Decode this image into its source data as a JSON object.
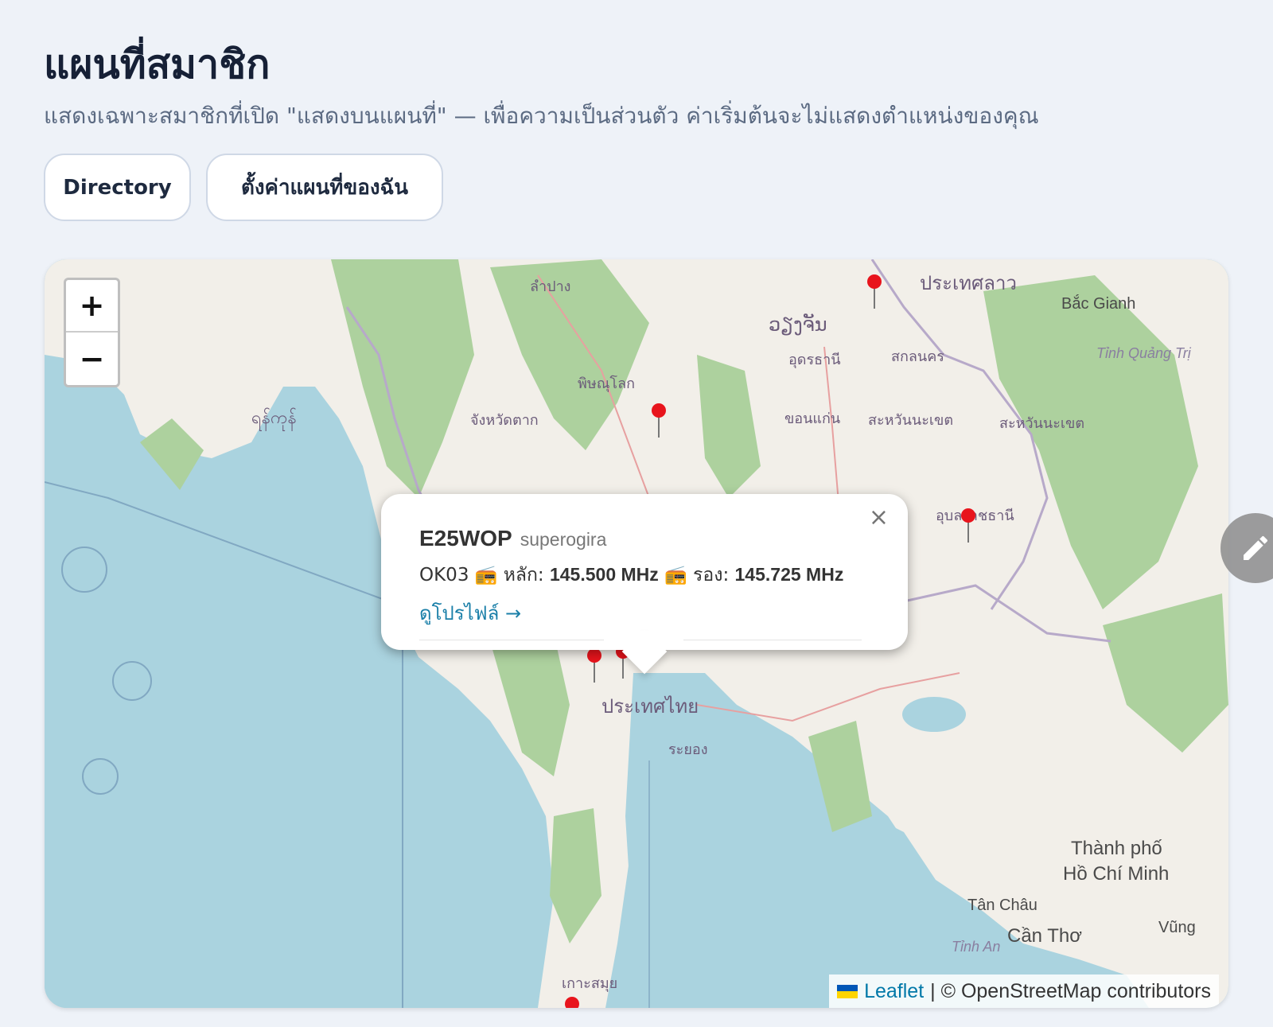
{
  "page": {
    "title": "แผนที่สมาชิก",
    "subtitle": "แสดงเฉพาะสมาชิกที่เปิด \"แสดงบนแผนที่\" — เพื่อความเป็นส่วนตัว ค่าเริ่มต้นจะไม่แสดงตำแหน่งของคุณ"
  },
  "actions": {
    "directory_label": "Directory",
    "my_map_settings_label": "ตั้งค่าแผนที่ของฉัน"
  },
  "map": {
    "zoom_in_label": "+",
    "zoom_out_label": "−",
    "marker_count": 6,
    "place_labels": {
      "lampang": "ลำปาง",
      "phitsanulok": "พิษณุโลก",
      "udon": "อุดรธานี",
      "sakon": "สกลนคร",
      "khonkaen": "ขอนแก่น",
      "savannakhet": "สะหวันนะเขต",
      "savannakhet2": "สะหวันนะเขต",
      "ubon": "อุบลราชธานี",
      "laos": "ประเทศลาว",
      "vientiane": "ວຽງຈັນ",
      "thailand": "ประเทศไทย",
      "rayong": "ระยอง",
      "tak": "จังหวัดตาก",
      "yangon": "ရန်ကုန်",
      "hcmc1": "Thành phố",
      "hcmc2": "Hồ Chí Minh",
      "cantho": "Cần Thơ",
      "tanchau": "Tân Châu",
      "vung": "Vũng",
      "bacgianh": "Bắc Gianh",
      "quangtri": "Tỉnh Quảng Trị",
      "tinhan": "Tỉnh An",
      "samui": "เกาะสมุย"
    },
    "popup": {
      "callsign": "E25WOP",
      "name": "superogira",
      "grid": "OK03",
      "primary_label": "หลัก:",
      "primary_freq": "145.500 MHz",
      "secondary_label": "รอง:",
      "secondary_freq": "145.725 MHz",
      "profile_link": "ดูโปรไฟล์ →",
      "close": "×"
    },
    "attribution": {
      "leaflet": "Leaflet",
      "rest": "| © OpenStreetMap contributors"
    }
  },
  "colors": {
    "background": "#eef2f8",
    "link": "#1a7fa8",
    "sea": "#aad3df",
    "land": "#f2efe9",
    "forest": "#add19e",
    "marker": "#e8141c"
  },
  "icons": {
    "radio": "radio-icon",
    "edit": "pencil-icon",
    "marker": "map-pin-icon"
  }
}
